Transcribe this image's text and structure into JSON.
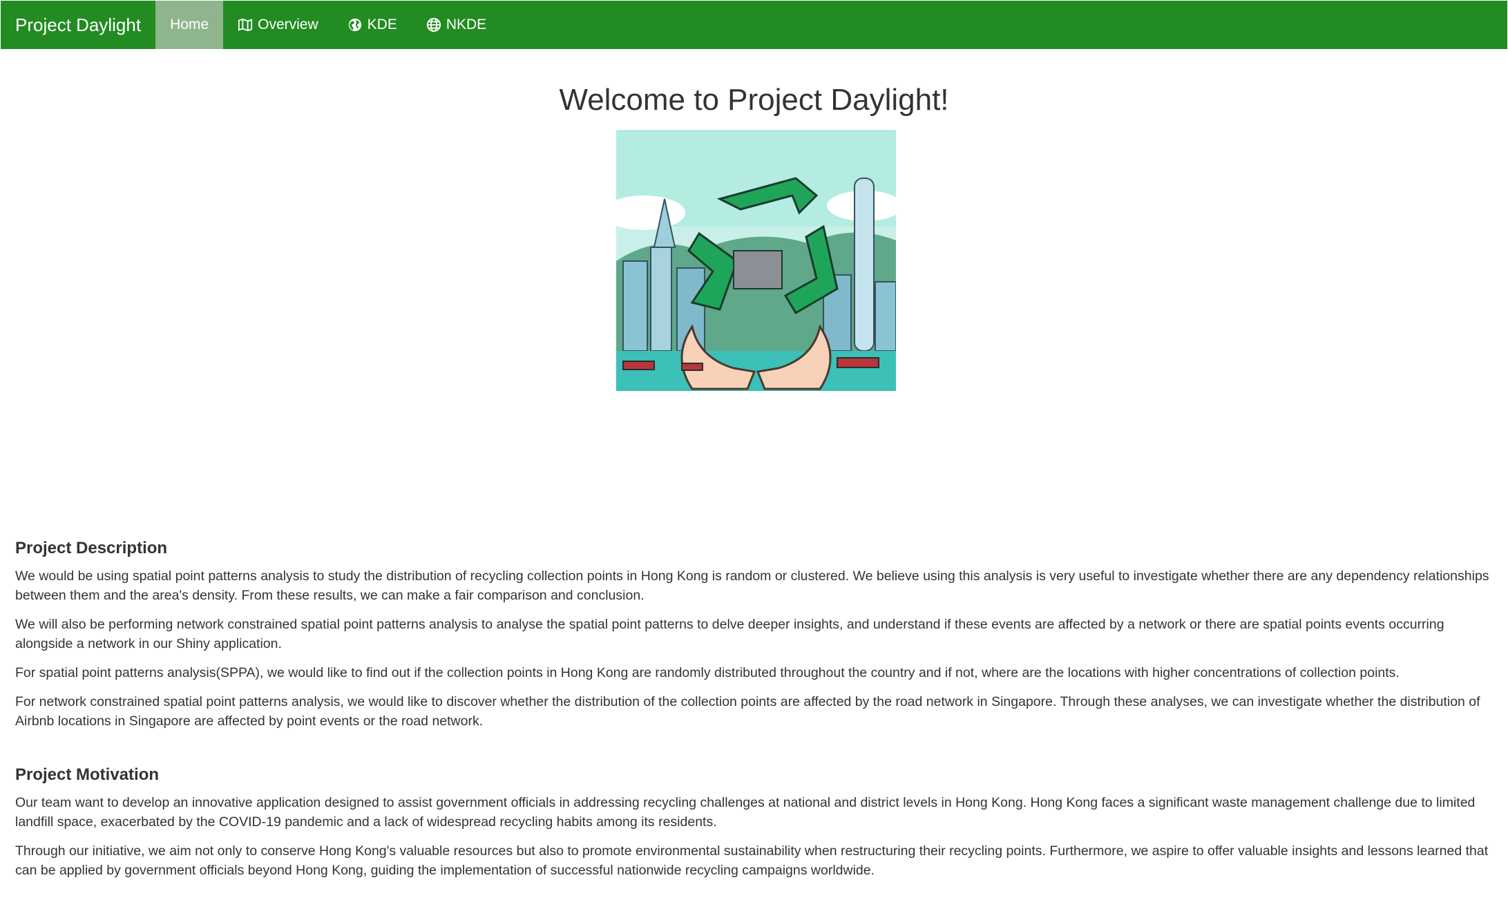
{
  "navbar": {
    "brand": "Project Daylight",
    "items": [
      {
        "label": "Home",
        "icon": "none",
        "active": true
      },
      {
        "label": "Overview",
        "icon": "map-icon",
        "active": false
      },
      {
        "label": "KDE",
        "icon": "globe-americas-icon",
        "active": false
      },
      {
        "label": "NKDE",
        "icon": "globe-icon",
        "active": false
      }
    ],
    "colors": {
      "background": "#228b22",
      "active": "#8fb58f",
      "text": "#ffffff"
    }
  },
  "main": {
    "title": "Welcome to Project Daylight!",
    "description": {
      "heading": "Project Description",
      "paragraphs": [
        "We would be using spatial point patterns analysis to study the distribution of recycling collection points in Hong Kong is random or clustered. We believe using this analysis is very useful to investigate whether there are any dependency relationships between them and the area's density. From these results, we can make a fair comparison and conclusion.",
        "We will also be performing network constrained spatial point patterns analysis to analyse the spatial point patterns to delve deeper insights, and understand if these events are affected by a network or there are spatial points events occurring alongside a network in our Shiny application.",
        "For spatial point patterns analysis(SPPA), we would like to find out if the collection points in Hong Kong are randomly distributed throughout the country and if not, where are the locations with higher concentrations of collection points.",
        "For network constrained spatial point patterns analysis, we would like to discover whether the distribution of the collection points are affected by the road network in Singapore. Through these analyses, we can investigate whether the distribution of Airbnb locations in Singapore are affected by point events or the road network."
      ]
    },
    "motivation": {
      "heading": "Project Motivation",
      "paragraphs": [
        "Our team want to develop an innovative application designed to assist government officials in addressing recycling challenges at national and district levels in Hong Kong. Hong Kong faces a significant waste management challenge due to limited landfill space, exacerbated by the COVID-19 pandemic and a lack of widespread recycling habits among its residents.",
        "Through our initiative, we aim not only to conserve Hong Kong's valuable resources but also to promote environmental sustainability when restructuring their recycling points. Furthermore, we aspire to offer valuable insights and lessons learned that can be applied by government officials beyond Hong Kong, guiding the implementation of successful nationwide recycling campaigns worldwide."
      ]
    }
  }
}
